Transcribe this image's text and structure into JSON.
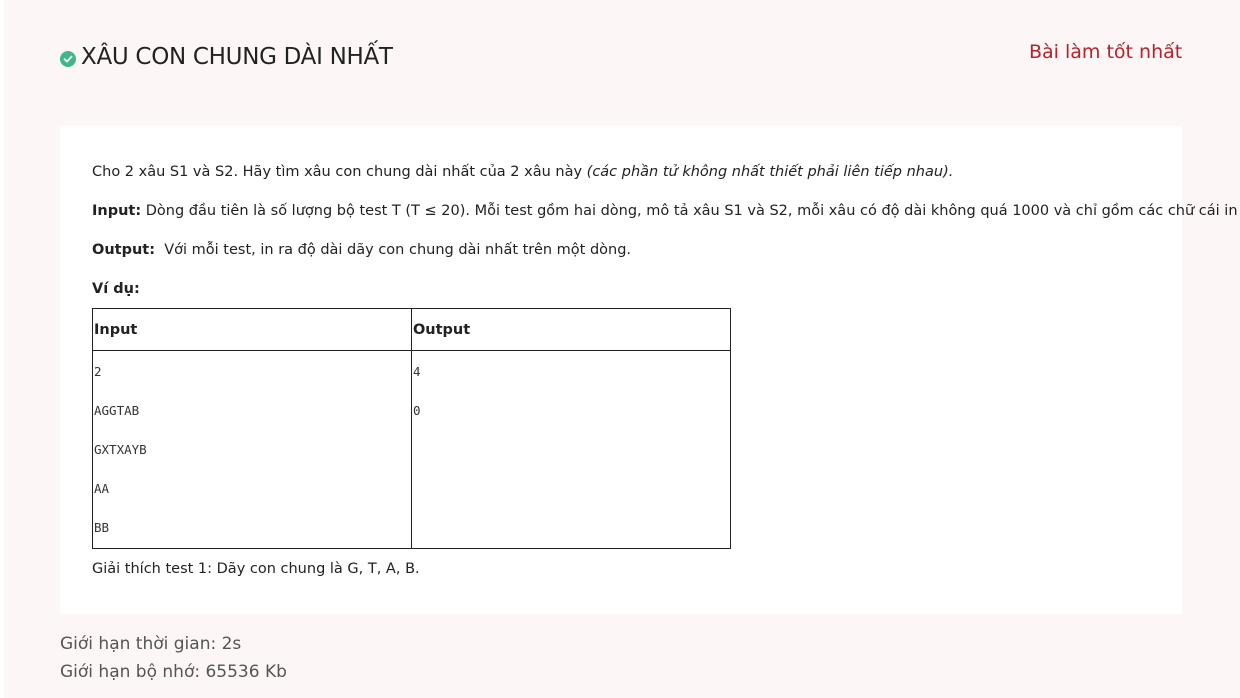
{
  "problem": {
    "title": "XÂU CON CHUNG DÀI NHẤT",
    "status_icon": "check-circle-icon",
    "best_submission_label": "Bài làm tốt nhất"
  },
  "statement": {
    "intro_text": "Cho 2 xâu S1 và S2. Hãy tìm xâu con chung dài nhất của 2 xâu này ",
    "intro_note": "(các phần tử không nhất thiết phải liên tiếp nhau).",
    "input_label": "Input:",
    "input_text": " Dòng đầu tiên là số lượng bộ test T (T ≤ 20). Mỗi test gồm hai dòng, mô tả xâu S1 và S2, mỗi xâu có độ dài không quá 1000 và chỉ gồm các chữ cái in hoa.",
    "output_label": "Output:",
    "output_text": "  Với mỗi test, in ra độ dài dãy con chung dài nhất trên một dòng.",
    "example_label": "Ví dụ:",
    "explanation": "Giải thích test 1: Dãy con chung là G, T, A, B."
  },
  "example_table": {
    "headers": [
      "Input",
      "Output"
    ],
    "input_lines": [
      "2",
      "AGGTAB",
      "GXTXAYB",
      "AA",
      "BB"
    ],
    "output_lines": [
      "4",
      "0"
    ]
  },
  "limits": {
    "time": "Giới hạn thời gian: 2s",
    "memory": "Giới hạn bộ nhớ: 65536 Kb"
  },
  "colors": {
    "accent_red": "#b5222a",
    "success_green": "#3fb68b",
    "page_background": "#fcf7f6"
  }
}
